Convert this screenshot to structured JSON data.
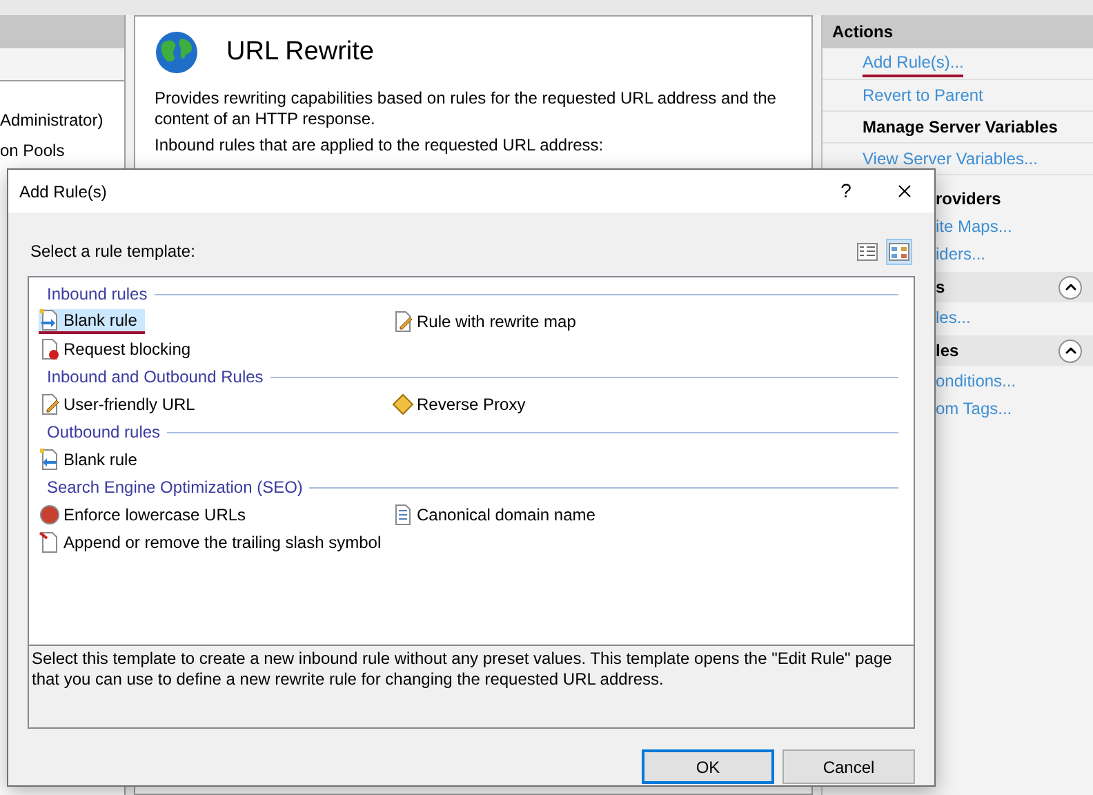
{
  "connections": {
    "items": [
      "Administrator)",
      "on Pools"
    ]
  },
  "feature": {
    "title": "URL Rewrite",
    "description": "Provides rewriting capabilities based on rules for the requested URL address and the content of an HTTP response.",
    "rules_label": "Inbound rules that are applied to the requested URL address:"
  },
  "actions": {
    "title": "Actions",
    "items": [
      {
        "kind": "link",
        "text": "Add Rule(s)...",
        "marked": true
      },
      {
        "kind": "link",
        "text": "Revert to Parent",
        "marked": false
      },
      {
        "kind": "heading",
        "text": "Manage Server Variables"
      },
      {
        "kind": "link",
        "text": "View Server Variables...",
        "marked": false
      }
    ],
    "items_under_dialog": [
      {
        "kind": "heading",
        "text": "roviders"
      },
      {
        "kind": "link",
        "text": "ite Maps..."
      },
      {
        "kind": "link",
        "text": "iders..."
      },
      {
        "kind": "section",
        "text": "s",
        "expanded": true
      },
      {
        "kind": "link",
        "text": "les..."
      },
      {
        "kind": "section",
        "text": "les",
        "expanded": true
      },
      {
        "kind": "link",
        "text": "onditions..."
      },
      {
        "kind": "link",
        "text": "om Tags..."
      }
    ]
  },
  "dialog": {
    "title": "Add Rule(s)",
    "help": "?",
    "prompt": "Select a rule template:",
    "views": [
      {
        "kind": "details",
        "selected": false
      },
      {
        "kind": "tiles",
        "selected": true
      }
    ],
    "groups": [
      {
        "title": "Inbound rules",
        "templates": [
          {
            "kind": "blank-inbound",
            "text": "Blank rule",
            "selected": true,
            "marked": true
          },
          {
            "kind": "edit",
            "text": "Rule with rewrite map",
            "selected": false,
            "marked": false
          },
          {
            "kind": "blocking",
            "text": "Request blocking",
            "selected": false,
            "marked": false
          }
        ]
      },
      {
        "title": "Inbound and Outbound Rules",
        "templates": [
          {
            "kind": "edit",
            "text": "User-friendly URL",
            "selected": false,
            "marked": false
          },
          {
            "kind": "proxy",
            "text": "Reverse Proxy",
            "selected": false,
            "marked": false
          }
        ]
      },
      {
        "title": "Outbound rules",
        "templates": [
          {
            "kind": "blank-outbound",
            "text": "Blank rule",
            "selected": false,
            "marked": false
          }
        ]
      },
      {
        "title": "Search Engine Optimization (SEO)",
        "templates": [
          {
            "kind": "lowercase",
            "text": "Enforce lowercase URLs",
            "selected": false,
            "marked": false
          },
          {
            "kind": "list",
            "text": "Canonical domain name",
            "selected": false,
            "marked": false
          },
          {
            "kind": "slash",
            "text": "Append or remove the trailing slash symbol",
            "selected": false,
            "marked": false
          }
        ]
      }
    ],
    "description": "Select this template to create a new inbound rule without any preset values. This template opens the \"Edit Rule\" page that you can use to define a new rewrite rule for changing the requested URL address.",
    "buttons": [
      {
        "text": "OK",
        "default": true
      },
      {
        "text": "Cancel",
        "default": false
      }
    ]
  }
}
